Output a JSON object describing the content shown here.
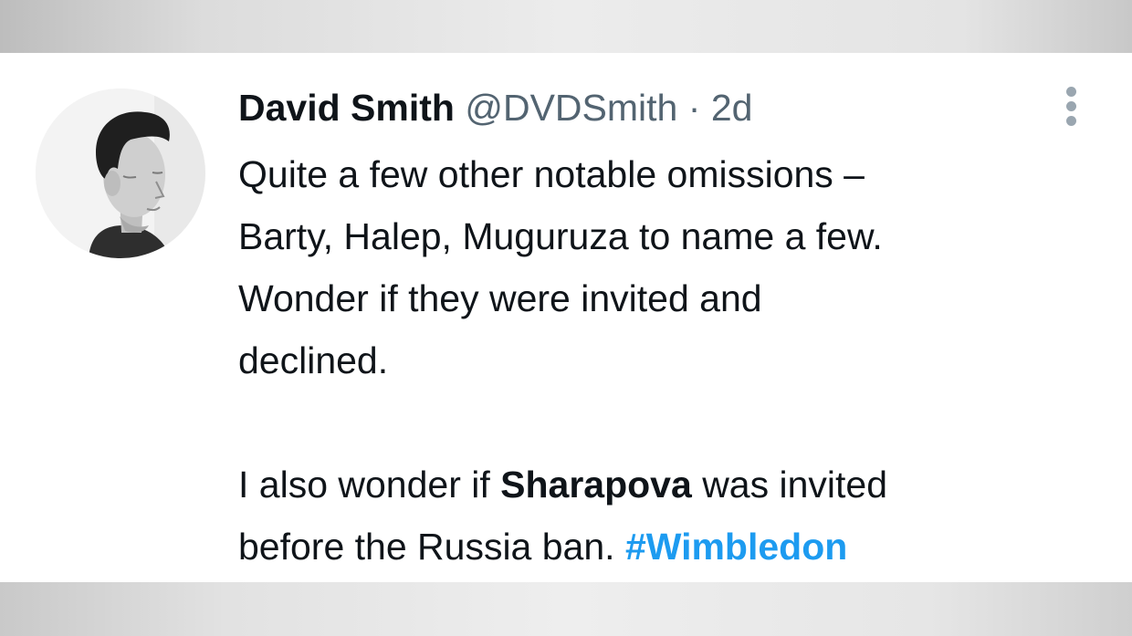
{
  "tweet": {
    "author_name": "David Smith",
    "author_handle": "@DVDSmith",
    "separator": "·",
    "time": "2d",
    "line1": "Quite a few other notable omissions –",
    "line2": "Barty, Halep, Muguruza to name a few.",
    "line3": "Wonder if they were invited and",
    "line4": "declined.",
    "line5_prefix": "I also wonder if ",
    "line5_bold": "Sharapova",
    "line5_suffix": " was invited",
    "line6_prefix": "before the Russia ban. ",
    "hashtag": "#Wimbledon"
  },
  "icons": {
    "more": "more-vertical-icon",
    "avatar": "profile-photo"
  },
  "colors": {
    "text": "#0f1419",
    "secondary": "#536471",
    "link": "#1d9bf0",
    "more_dots": "#9aa6b0"
  }
}
